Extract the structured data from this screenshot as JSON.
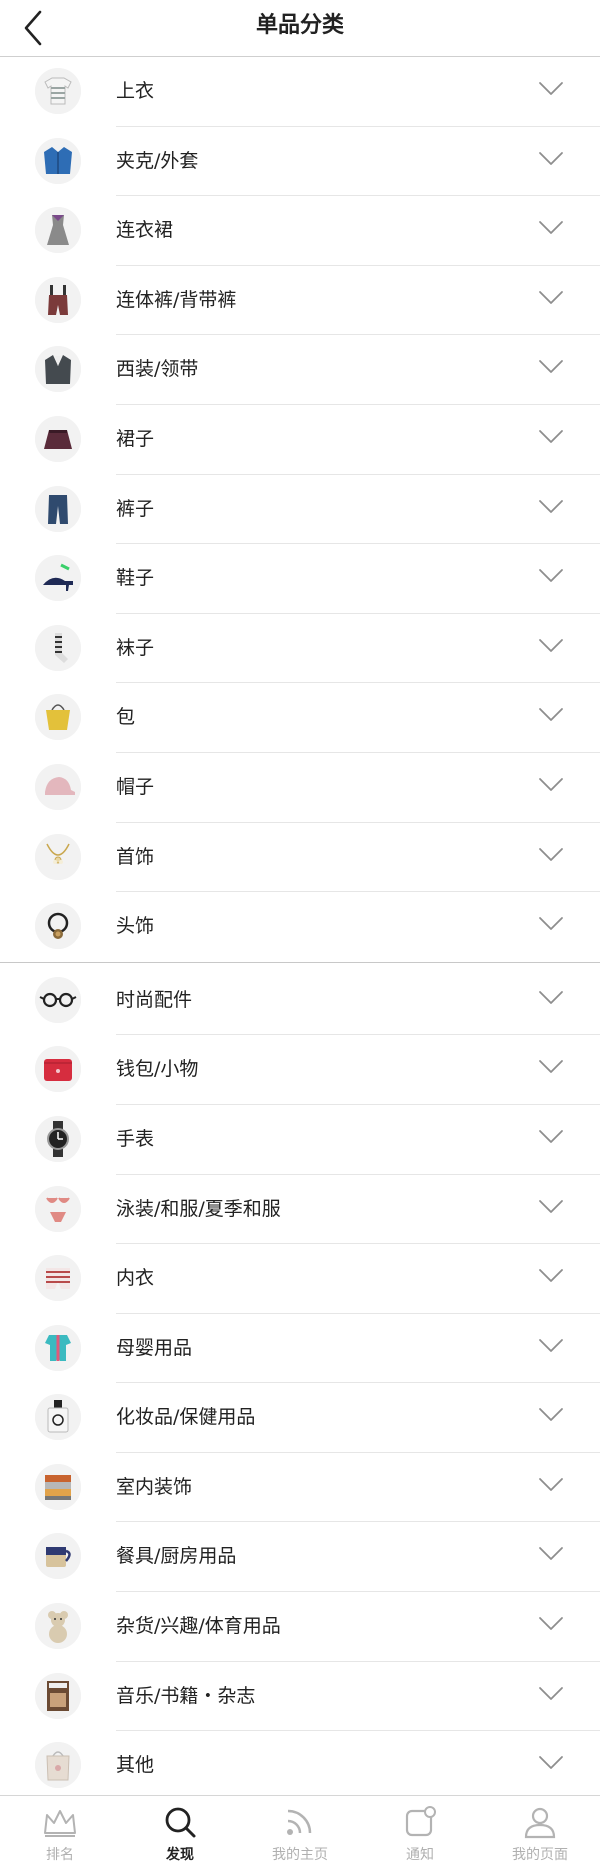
{
  "header": {
    "title": "单品分类"
  },
  "sections": [
    {
      "items": [
        {
          "label": "上衣",
          "icon": "striped-tshirt-icon",
          "color": "#9aa5a3"
        },
        {
          "label": "夹克/外套",
          "icon": "blue-jacket-icon",
          "color": "#2e6db5"
        },
        {
          "label": "连衣裙",
          "icon": "dress-icon",
          "color": "#8a8a8a"
        },
        {
          "label": "连体裤/背带裤",
          "icon": "overalls-icon",
          "color": "#7b3a3a"
        },
        {
          "label": "西装/领带",
          "icon": "suit-icon",
          "color": "#444a4f"
        },
        {
          "label": "裙子",
          "icon": "skirt-icon",
          "color": "#5a2b3a"
        },
        {
          "label": "裤子",
          "icon": "jeans-icon",
          "color": "#2f4a6e"
        },
        {
          "label": "鞋子",
          "icon": "high-heel-icon",
          "color": "#1f2a55"
        },
        {
          "label": "袜子",
          "icon": "socks-icon",
          "color": "#333333"
        },
        {
          "label": "包",
          "icon": "bag-icon",
          "color": "#e3c13a"
        },
        {
          "label": "帽子",
          "icon": "cap-icon",
          "color": "#e3b7bd"
        },
        {
          "label": "首饰",
          "icon": "necklace-icon",
          "color": "#c9a74e"
        },
        {
          "label": "头饰",
          "icon": "hair-tie-icon",
          "color": "#222222"
        }
      ]
    },
    {
      "items": [
        {
          "label": "时尚配件",
          "icon": "glasses-icon",
          "color": "#222222"
        },
        {
          "label": "钱包/小物",
          "icon": "wallet-icon",
          "color": "#d62d3f"
        },
        {
          "label": "手表",
          "icon": "watch-icon",
          "color": "#222222"
        },
        {
          "label": "泳装/和服/夏季和服",
          "icon": "bikini-icon",
          "color": "#e08a84"
        },
        {
          "label": "内衣",
          "icon": "underwear-icon",
          "color": "#b84a4a"
        },
        {
          "label": "母婴用品",
          "icon": "baby-romper-icon",
          "color": "#3bbac0"
        },
        {
          "label": "化妆品/保健用品",
          "icon": "perfume-icon",
          "color": "#222222"
        },
        {
          "label": "室内装饰",
          "icon": "towels-icon",
          "color": "#c8632e"
        },
        {
          "label": "餐具/厨房用品",
          "icon": "mug-icon",
          "color": "#2f3a72"
        },
        {
          "label": "杂货/兴趣/体育用品",
          "icon": "teddy-bear-icon",
          "color": "#d9cbb0"
        },
        {
          "label": "音乐/书籍・杂志",
          "icon": "magazine-icon",
          "color": "#6b4a33"
        },
        {
          "label": "其他",
          "icon": "gift-bag-icon",
          "color": "#e6dcd2"
        }
      ]
    }
  ],
  "tabbar": {
    "tabs": [
      {
        "label": "排名",
        "icon": "crown-icon",
        "active": false
      },
      {
        "label": "发现",
        "icon": "search-icon",
        "active": true
      },
      {
        "label": "我的主页",
        "icon": "feed-icon",
        "active": false
      },
      {
        "label": "通知",
        "icon": "notification-icon",
        "active": false
      },
      {
        "label": "我的页面",
        "icon": "user-icon",
        "active": false
      }
    ]
  }
}
